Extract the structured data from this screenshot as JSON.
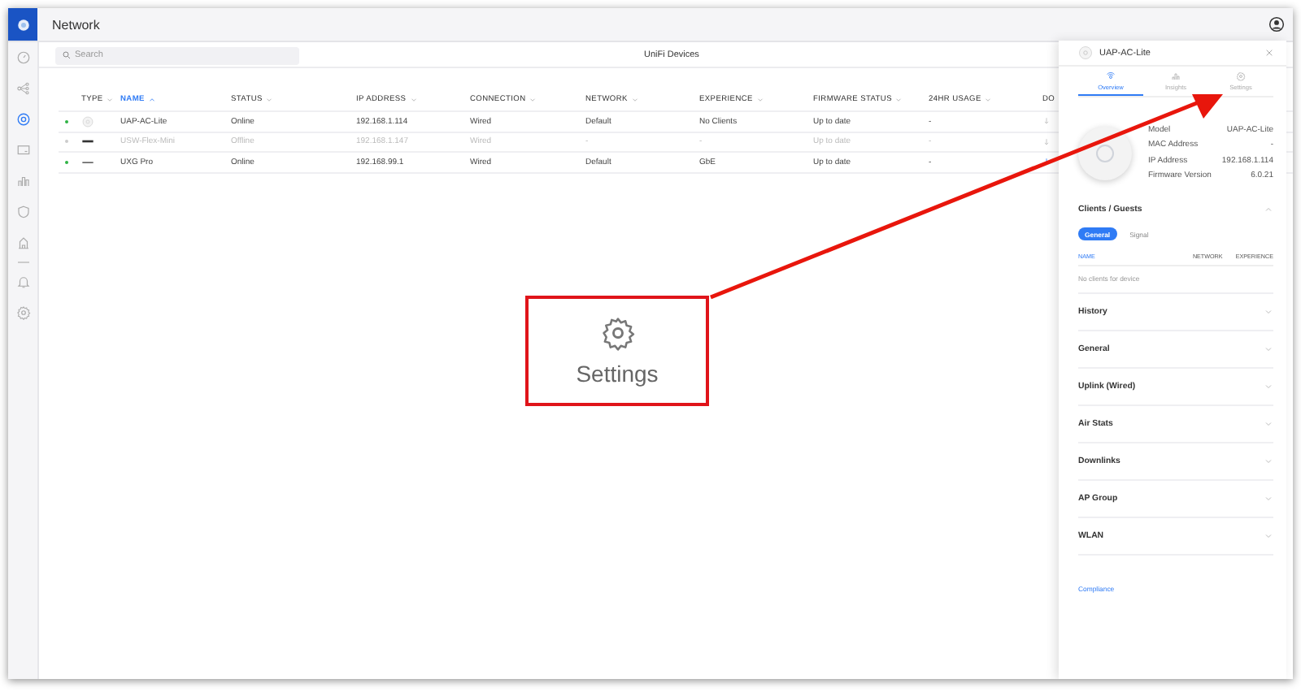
{
  "window": {
    "title": "Network"
  },
  "sidebar": {
    "items": [
      {
        "selected": false
      },
      {
        "selected": false
      },
      {
        "selected": true
      },
      {
        "selected": false
      },
      {
        "selected": false
      },
      {
        "selected": false
      },
      {
        "selected": false
      },
      {
        "selected": false
      },
      {
        "selected": false
      }
    ]
  },
  "search": {
    "placeholder": "Search"
  },
  "page_title": "UniFi Devices",
  "table": {
    "columns": [
      {
        "label": "TYPE",
        "sorted": false
      },
      {
        "label": "NAME",
        "sorted": true
      },
      {
        "label": "STATUS",
        "sorted": false
      },
      {
        "label": "IP ADDRESS",
        "sorted": false
      },
      {
        "label": "CONNECTION",
        "sorted": false
      },
      {
        "label": "NETWORK",
        "sorted": false
      },
      {
        "label": "EXPERIENCE",
        "sorted": false
      },
      {
        "label": "FIRMWARE STATUS",
        "sorted": false
      },
      {
        "label": "24HR USAGE",
        "sorted": false
      },
      {
        "label": "DO",
        "sorted": false
      }
    ],
    "rows": [
      {
        "color": "#2fb344",
        "disabled": false,
        "cells": [
          "",
          "UAP-AC-Lite",
          "Online",
          "192.168.1.114",
          "Wired",
          "Default",
          "No Clients",
          "Up to date",
          "-",
          ""
        ]
      },
      {
        "color": "#cccccc",
        "disabled": true,
        "cells": [
          "",
          "USW-Flex-Mini",
          "Offline",
          "192.168.1.147",
          "Wired",
          "-",
          "-",
          "Up to date",
          "-",
          ""
        ]
      },
      {
        "color": "#2fb344",
        "disabled": false,
        "cells": [
          "",
          "UXG Pro",
          "Online",
          "192.168.99.1",
          "Wired",
          "Default",
          "GbE",
          "Up to date",
          "-",
          ""
        ]
      }
    ]
  },
  "panel": {
    "title": "UAP-AC-Lite",
    "tabs": [
      {
        "label": "Overview",
        "selected": true
      },
      {
        "label": "Insights",
        "selected": false
      },
      {
        "label": "Settings",
        "selected": false
      }
    ],
    "properties": [
      {
        "label": "Model",
        "value": "UAP-AC-Lite"
      },
      {
        "label": "MAC Address",
        "value": "-"
      },
      {
        "label": "IP Address",
        "value": "192.168.1.114"
      },
      {
        "label": "Firmware Version",
        "value": "6.0.21"
      }
    ],
    "sections": [
      {
        "title": "Clients / Guests",
        "expanded": true,
        "toggles": [
          {
            "label": "General",
            "selected": true
          },
          {
            "label": "Signal",
            "selected": false
          }
        ],
        "columns": [
          "NAME",
          "NETWORK",
          "EXPERIENCE"
        ],
        "empty": "No clients for device"
      },
      {
        "title": "History",
        "expanded": false
      },
      {
        "title": "General",
        "expanded": false
      },
      {
        "title": "Uplink (Wired)",
        "expanded": false
      },
      {
        "title": "Air Stats",
        "expanded": false
      },
      {
        "title": "Downlinks",
        "expanded": false
      },
      {
        "title": "AP Group",
        "expanded": false
      },
      {
        "title": "WLAN",
        "expanded": false
      }
    ],
    "link": "Compliance"
  },
  "callout": {
    "label": "Settings"
  }
}
